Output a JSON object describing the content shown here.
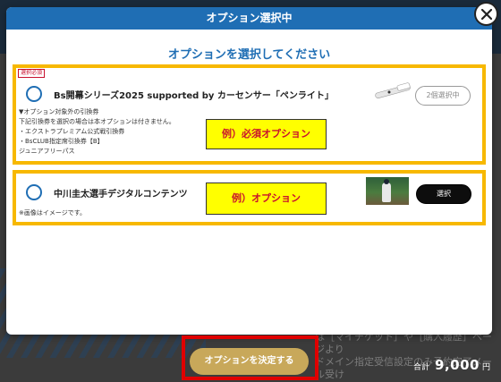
{
  "modal": {
    "header": "オプション選択中",
    "title": "オプションを選択してください"
  },
  "options": [
    {
      "badge": "選択必須",
      "name": "Bs開幕シリーズ2025 supported by カーセンサー「ペンライト」",
      "description": [
        "▼オプション対象外の引換券",
        "下記引換券を選択の場合は本オプションは付きません。",
        "・エクストラプレミアム公式戦引換券",
        "・BsCLUB指定席引換券【B】",
        "ジュニアフリーパス"
      ],
      "button": "2個選択中",
      "example_label": "例）必須オプション",
      "thumbnail_icon": "penlight-icon"
    },
    {
      "name": "中川圭太選手デジタルコンテンツ",
      "note": "※画像はイメージです。",
      "button": "選択",
      "example_label": "例）オプション",
      "thumbnail_icon": "player-photo"
    }
  ],
  "footer": {
    "decide_button": "オプションを決定する",
    "total_label": "合計",
    "total_amount": "9,000",
    "total_unit": "円"
  },
  "background_text": "しています。予約・予約済み。\nは［マイチケット］や［購入履歴］ページより\nドメイン指定受信設定のみ予約完了メール受け",
  "colors": {
    "header_blue": "#1f6eb4",
    "highlight_yellow": "#f7b800",
    "example_red": "#c8102e",
    "decide_gold": "#c8a85a",
    "annotation_red": "#e00000"
  }
}
